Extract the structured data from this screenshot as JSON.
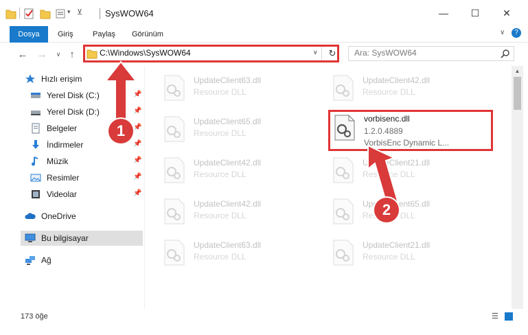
{
  "window": {
    "title": "SysWOW64",
    "minimize": "—",
    "maximize": "☐",
    "close": "✕",
    "help": "?"
  },
  "ribbon": {
    "tabs": [
      "Dosya",
      "Giriş",
      "Paylaş",
      "Görünüm"
    ]
  },
  "nav": {
    "back": "←",
    "forward": "→",
    "recent": "∨",
    "up": "↑",
    "address": "C:\\Windows\\SysWOW64",
    "dropdown": "∨",
    "refresh": "↻",
    "search_placeholder": "Ara: SysWOW64"
  },
  "sidebar": {
    "items": [
      {
        "label": "Hızlı erişim",
        "icon": "star-icon",
        "pinned": false
      },
      {
        "label": "Yerel Disk (C:)",
        "icon": "drive-icon",
        "pinned": true
      },
      {
        "label": "Yerel Disk (D:)",
        "icon": "drive-icon",
        "pinned": true
      },
      {
        "label": "Belgeler",
        "icon": "document-icon",
        "pinned": true
      },
      {
        "label": "İndirmeler",
        "icon": "download-icon",
        "pinned": true
      },
      {
        "label": "Müzik",
        "icon": "music-icon",
        "pinned": true
      },
      {
        "label": "Resimler",
        "icon": "picture-icon",
        "pinned": true
      },
      {
        "label": "Videolar",
        "icon": "video-icon",
        "pinned": true
      },
      {
        "label": "OneDrive",
        "icon": "cloud-icon",
        "pinned": false
      },
      {
        "label": "Bu bilgisayar",
        "icon": "computer-icon",
        "pinned": false
      },
      {
        "label": "Ağ",
        "icon": "network-icon",
        "pinned": false
      }
    ],
    "pin_glyph": "📌"
  },
  "files": [
    {
      "name": "UpdateClient63.dll",
      "type": "Resource DLL"
    },
    {
      "name": "UpdateClient42.dll",
      "type": "Resource DLL"
    },
    {
      "name": "UpdateClient65.dll",
      "type": "Resource DLL"
    },
    {
      "name": "vorbisenc.dll",
      "version": "1.2.0.4889",
      "description": "VorbisEnc Dynamic L..."
    },
    {
      "name": "UpdateClient42.dll",
      "type": "Resource DLL"
    },
    {
      "name": "UpdateClient21.dll",
      "type": "Resource DLL"
    },
    {
      "name": "UpdateClient42.dll",
      "type": "Resource DLL"
    },
    {
      "name": "UpdateClient65.dll",
      "type": "Resource DLL"
    },
    {
      "name": "UpdateClient63.dll",
      "type": "Resource DLL"
    },
    {
      "name": "UpdateClient21.dll",
      "type": "Resource DLL"
    }
  ],
  "status": {
    "count": "173 öğe"
  },
  "annotations": {
    "step1": "1",
    "step2": "2",
    "color": "#e03434"
  }
}
